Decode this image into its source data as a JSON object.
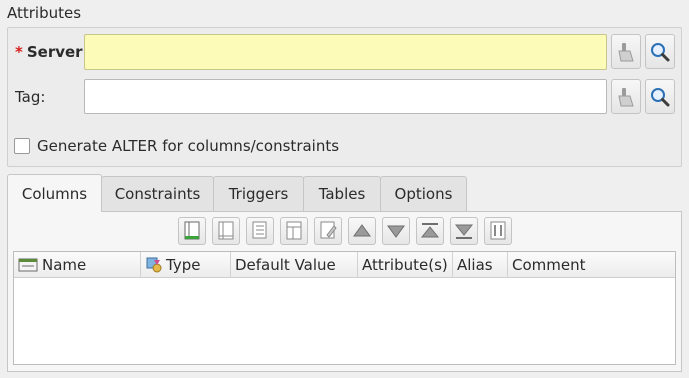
{
  "attributes": {
    "title": "Attributes",
    "server": {
      "required_mark": "*",
      "label": "Server:",
      "value": ""
    },
    "tag": {
      "label": "Tag:",
      "value": ""
    },
    "generate_alter": {
      "label": "Generate ALTER for columns/constraints",
      "checked": false
    },
    "icons": {
      "clear": "broom-icon",
      "search": "magnifier-icon"
    }
  },
  "tabs": [
    {
      "label": "Columns",
      "active": true
    },
    {
      "label": "Constraints",
      "active": false
    },
    {
      "label": "Triggers",
      "active": false
    },
    {
      "label": "Tables",
      "active": false
    },
    {
      "label": "Options",
      "active": false
    }
  ],
  "columns_toolbar": [
    "add-column-icon",
    "insert-column-icon",
    "duplicate-column-icon",
    "edit-column-icon",
    "edit-data-icon",
    "move-up-icon",
    "move-down-icon",
    "move-top-icon",
    "move-bottom-icon",
    "split-icon"
  ],
  "table": {
    "headers": [
      "Name",
      "Type",
      "Default Value",
      "Attribute(s)",
      "Alias",
      "Comment"
    ],
    "rows": []
  },
  "colors": {
    "required_bg": "#fdfbb8",
    "required_star": "#d61f1f"
  }
}
